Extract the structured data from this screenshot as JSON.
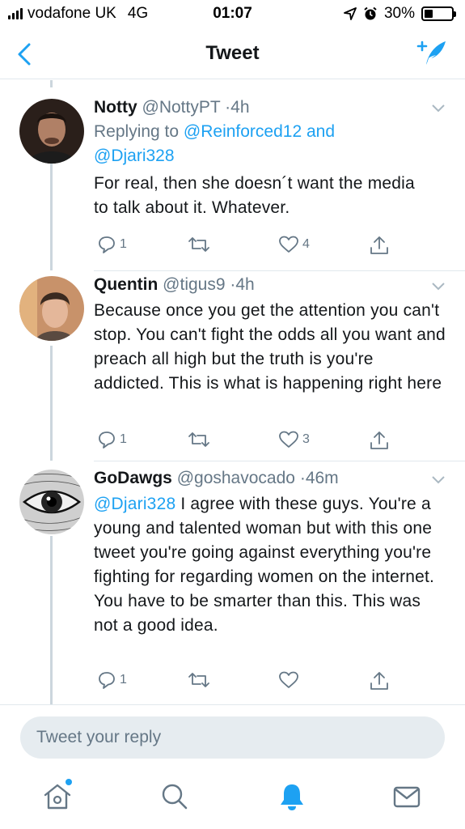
{
  "status_bar": {
    "carrier": "vodafone UK",
    "network": "4G",
    "time": "01:07",
    "battery_percent": "30%",
    "battery_level": 0.3
  },
  "nav": {
    "title": "Tweet",
    "back_icon": "chevron-left-icon",
    "compose_icon": "compose-tweet-icon"
  },
  "tweets": [
    {
      "name": "Notty",
      "handle": "@NottyPT",
      "time": "4h",
      "replying_prefix": "Replying to",
      "replying_mention_1": "@Reinforced12",
      "replying_and": "and",
      "replying_mention_2": "@Djari328",
      "text": "For real, then she doesn´t want the media to talk about it. Whatever.",
      "replies": "1",
      "retweets": "",
      "likes": "4"
    },
    {
      "name": "Quentin",
      "handle": "@tigus9",
      "time": "4h",
      "text": "Because once you get the attention you can't stop. You can't fight the odds all you want and preach all high but the truth is you're addicted. This is what is happening right here",
      "replies": "1",
      "retweets": "",
      "likes": "3"
    },
    {
      "name": "GoDawgs",
      "handle": "@goshavocado",
      "time": "46m",
      "mention": "@Djari328",
      "text": " I agree with these guys. You're a young and talented woman but with this one tweet you're going against everything you're fighting for regarding women on the internet.  You have to be smarter than this.  This was not a good idea.",
      "replies": "1",
      "retweets": "",
      "likes": ""
    }
  ],
  "reply_box": {
    "placeholder": "Tweet your reply"
  },
  "tab_bar": {
    "items": [
      "home-icon",
      "search-icon",
      "notifications-icon",
      "messages-icon"
    ],
    "active": "notifications-icon"
  },
  "colors": {
    "accent": "#1da1f2",
    "secondary_text": "#657786",
    "divider": "#e1e8ed"
  }
}
